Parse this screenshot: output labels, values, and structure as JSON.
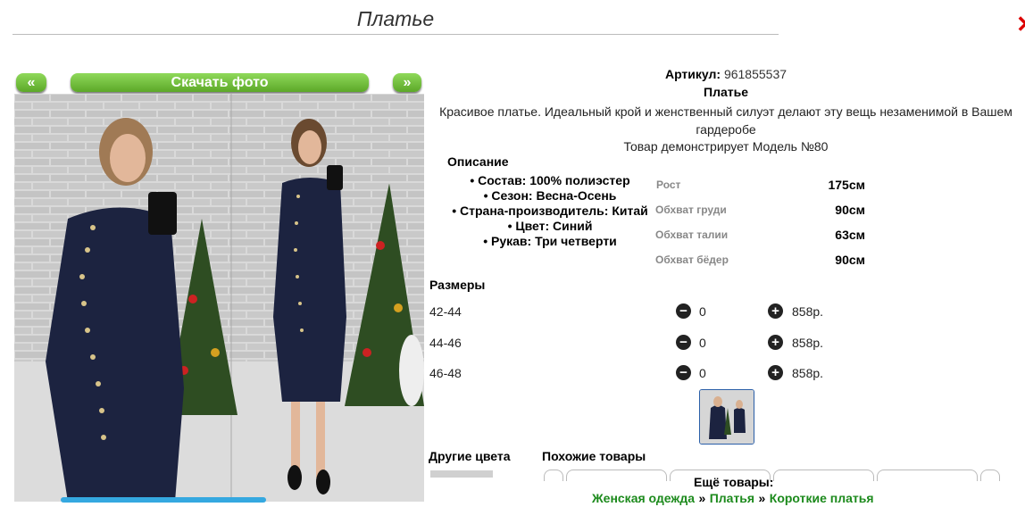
{
  "page_title": "Платье",
  "gallery": {
    "prev_label": "«",
    "download_label": "Скачать фото",
    "next_label": "»"
  },
  "product": {
    "article_label": "Артикул:",
    "article_value": "961855537",
    "name": "Платье",
    "description": "Красивое платье. Идеальный крой и женственный силуэт делают эту вещь незаменимой в Вашем гардеробе",
    "model_note": "Товар демонстрирует Модель №80"
  },
  "specs": {
    "heading": "Описание",
    "items": [
      "Состав: 100% полиэстер",
      "Сезон: Весна-Осень",
      "Страна-производитель: Китай",
      "Цвет: Синий",
      "Рукав: Три четверти"
    ]
  },
  "measurements": [
    {
      "label": "Рост",
      "value": "175см"
    },
    {
      "label": "Обхват груди",
      "value": "90см"
    },
    {
      "label": "Обхват талии",
      "value": "63см"
    },
    {
      "label": "Обхват бёдер",
      "value": "90см"
    }
  ],
  "sizes": {
    "heading": "Размеры",
    "rows": [
      {
        "size": "42-44",
        "qty": "0",
        "price": "858р."
      },
      {
        "size": "44-46",
        "qty": "0",
        "price": "858р."
      },
      {
        "size": "46-48",
        "qty": "0",
        "price": "858р."
      }
    ]
  },
  "sections": {
    "other_colors": "Другие цвета",
    "similar": "Похожие товары",
    "more_products": "Ещё товары:"
  },
  "breadcrumb": [
    "Женская одежда",
    "Платья",
    "Короткие платья"
  ],
  "breadcrumb_separator": "»",
  "colors": {
    "accent_green": "#5ca828",
    "link_green": "#1c8a1c",
    "dress_navy": "#1c2340"
  },
  "icons": {
    "minus": "minus-circle-icon",
    "plus": "plus-circle-icon",
    "close": "close-icon"
  }
}
